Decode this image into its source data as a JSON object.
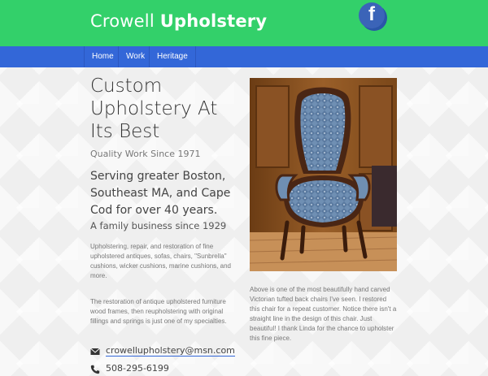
{
  "header": {
    "brand_light": "Crowell",
    "brand_bold": "Upholstery",
    "facebook_letter": "f"
  },
  "nav": {
    "items": [
      {
        "label": "Home"
      },
      {
        "label": "Work"
      },
      {
        "label": "Heritage"
      }
    ]
  },
  "main": {
    "title": "Custom Upholstery At Its Best",
    "tagline": "Quality Work Since 1971",
    "serving": "Serving greater Boston, Southeast MA, and Cape Cod for over 40 years.",
    "family": "A family business since 1929",
    "paragraph1": "Upholstering, repair, and restoration of fine upholstered antiques, sofas, chairs, \"Sunbrella\" cushions, wicker cushions, marine cushions, and more.",
    "paragraph2": "The restoration of antique upholstered furniture wood frames, then reupholstering with original fillings and springs is just one of my specialties.",
    "email": "crowellupholstery@msn.com",
    "phone": "508-295-6199"
  },
  "photo": {
    "caption": "Above is one of the most beautifully hand carved Victorian tufted back chairs I've seen. I restored this chair for a repeat customer. Notice there isn't a straight line in the design of this chair. Just beautiful! I thank Linda for the chance to upholster this fine piece."
  },
  "colors": {
    "header_green": "#33d06a",
    "nav_blue": "#3367d8",
    "facebook_blue": "#3b64b8"
  },
  "icons": [
    "facebook-icon",
    "envelope-icon",
    "phone-icon"
  ]
}
